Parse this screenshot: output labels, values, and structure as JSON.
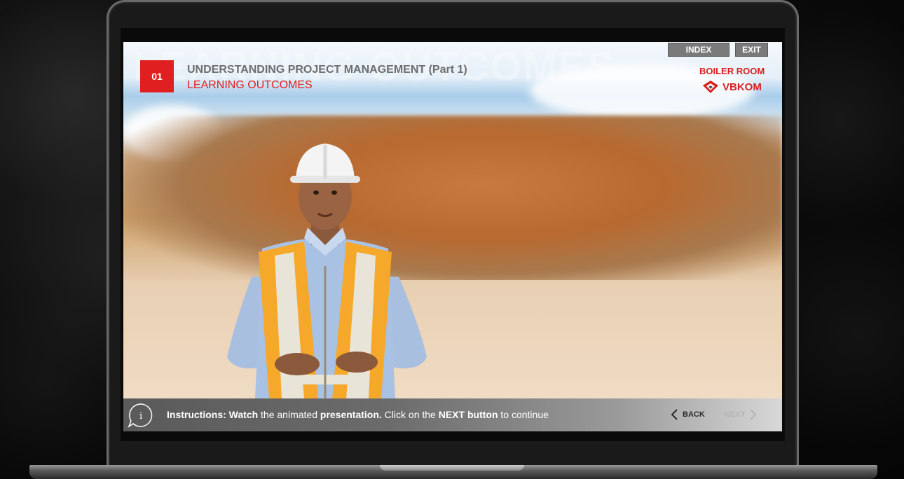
{
  "header": {
    "watermark": "LEARNING OUTCOMES",
    "module_number": "01",
    "module_title": "UNDERSTANDING PROJECT MANAGEMENT (Part 1)",
    "section_title": "LEARNING OUTCOMES"
  },
  "top_nav": {
    "index_label": "INDEX",
    "exit_label": "EXIT"
  },
  "logos": {
    "boiler_room": "BOILER ROOM",
    "vbkom": "VBKOM"
  },
  "instructions": {
    "label": "Instructions:",
    "w1": "Watch",
    "t1": "the animated",
    "w2": "presentation.",
    "t2": "Click on the",
    "w3": "NEXT button",
    "t3": "to continue"
  },
  "navigation": {
    "back_label": "BACK",
    "next_label": "NEXT"
  },
  "icons": {
    "info": "info-icon",
    "back": "chevron-left-icon",
    "next": "chevron-right-icon",
    "vbkom": "vbkom-logo-icon"
  },
  "colors": {
    "accent_red": "#e02020",
    "bar_gray": "#6b6b6b"
  }
}
